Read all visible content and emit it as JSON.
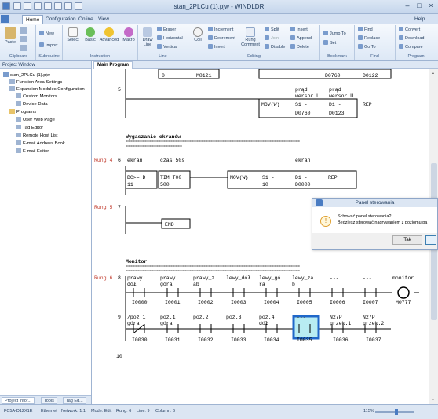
{
  "window": {
    "title": "stan_2PLCu (1).pjw - WINDLDR",
    "help": "Help"
  },
  "tabs": [
    "Home",
    "Configuration",
    "Online",
    "View"
  ],
  "ribbon": {
    "clipboard": {
      "label": "Clipboard",
      "paste": "Paste"
    },
    "subroutine": {
      "label": "Subroutine",
      "new": "New",
      "import": "Import"
    },
    "instruction": {
      "label": "Instruction",
      "select": "Select",
      "basic": "Basic",
      "advanced": "Advanced",
      "macro": "Macro"
    },
    "line": {
      "label": "Line",
      "draw": "Draw Line",
      "eraser": "Eraser",
      "horizontal": "Horizontal",
      "vertical": "Vertical"
    },
    "editing": {
      "label": "Editing",
      "coil": "Coil",
      "increment": "Increment",
      "decrement": "Decrement",
      "invert": "Invert",
      "rung_comment": "Rung Comment",
      "split": "Split",
      "join": "Join",
      "disable": "Disable",
      "insert": "Insert",
      "append": "Append",
      "delete": "Delete"
    },
    "bookmark": {
      "label": "Bookmark",
      "jump": "Jump To",
      "set": "Set"
    },
    "find": {
      "label": "Find",
      "find": "Find",
      "replace": "Replace",
      "goto": "Go To"
    },
    "program": {
      "label": "Program",
      "convert": "Convert",
      "download": "Download",
      "compare": "Compare"
    }
  },
  "project": {
    "title": "Project Window",
    "root": "stan_2PLCu (1).pjw",
    "items": [
      "Function Area Settings",
      "Expansion Modules Configuration",
      "Custom Monitors",
      "Device Data",
      "Programs",
      "User Web Page",
      "Tag Editor",
      "Remote Host List",
      "E-mail Address Book",
      "E-mail Editor"
    ],
    "tabs": [
      "Project Infor...",
      "Tools",
      "Tag Ed..."
    ]
  },
  "editor": {
    "tab": "Main Program",
    "top": {
      "rung_no": "5",
      "c0": "0",
      "c0b": "M8121",
      "c1": "D0760",
      "c1b": "D0122",
      "lbl1": "prąd",
      "lbl1b": "wersor.U",
      "lbl2": "prąd",
      "lbl2b": "wersor.U",
      "mov": "MOV(W)",
      "s1": "S1 -",
      "s1b": "D0760",
      "d1": "D1 -",
      "d1b": "D0123",
      "rep": "REP"
    },
    "sec1": {
      "title": "Wygaszanie ekranów",
      "rung": "Rung 4",
      "no": "6",
      "c_ekran": "ekran",
      "c_czas": "czas 50s",
      "c_ekran2": "ekran",
      "cmp": "DC>= D",
      "cmp2": "11",
      "tim": "TIM T00",
      "tim2": "500",
      "mov": "MOV(W)",
      "s1": "S1 -",
      "s1b": "10",
      "d1": "D1 -",
      "d1b": "D0000",
      "rep": "REP"
    },
    "rung5": {
      "rung": "Rung 5",
      "no": "7",
      "end": "END"
    },
    "sec2": {
      "title": "Monitor",
      "rung": "Rung 6",
      "row8": "8",
      "row9": "9",
      "row10": "10",
      "r8": [
        {
          "l1": "prawy",
          "l2": "dół",
          "a": "I0000"
        },
        {
          "l1": "prawy",
          "l2": "góra",
          "a": "I0001"
        },
        {
          "l1": "prawy_z",
          "l2": "ab",
          "a": "I0002"
        },
        {
          "l1": "lewy_dół",
          "l2": "",
          "a": "I0003"
        },
        {
          "l1": "lewy_gó",
          "l2": "ra",
          "a": "I0004"
        },
        {
          "l1": "lewy_za",
          "l2": "b",
          "a": "I0005"
        },
        {
          "l1": "---",
          "l2": "",
          "a": "I0006"
        },
        {
          "l1": "---",
          "l2": "",
          "a": "I0007"
        }
      ],
      "coil": {
        "l1": "monitor",
        "a": "M0777"
      },
      "r9": [
        {
          "l1": "/poz.1",
          "l2": "góra",
          "a": "I0030"
        },
        {
          "l1": "poz.1",
          "l2": "góra",
          "a": "I0031"
        },
        {
          "l1": "poz.2",
          "l2": "",
          "a": "I0032"
        },
        {
          "l1": "poz.3",
          "l2": "",
          "a": "I0033"
        },
        {
          "l1": "poz.4",
          "l2": "dół",
          "a": "I0034"
        },
        {
          "l1": "---",
          "l2": "",
          "a": "I0035"
        },
        {
          "l1": "N27P",
          "l2": "przek.1",
          "a": "I0036"
        },
        {
          "l1": "N27P",
          "l2": "przek.2",
          "a": "I0037"
        }
      ]
    }
  },
  "dialog": {
    "title": "Panel sterowania",
    "q": "Schować panel sterowania?",
    "q2": "Będziesz sterować nagrywaniem z poziomu pa",
    "yes": "Tak"
  },
  "status": {
    "plc": "FC5A-D12X1E",
    "conn": "Ethernet",
    "net": "Network: 1:1",
    "mode": "Mode: Edit",
    "rung": "Rung: 6",
    "line": "Line: 9",
    "col": "Column: 6",
    "zoom": "115%"
  }
}
